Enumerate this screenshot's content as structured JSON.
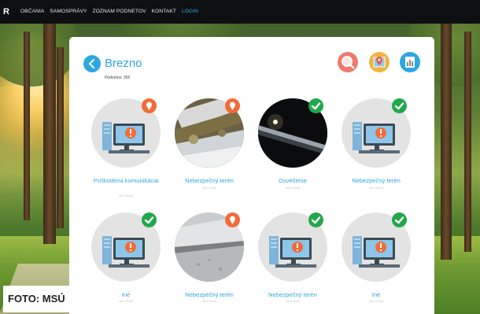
{
  "nav": {
    "logo": "R",
    "items": [
      "OBČANIA",
      "SAMOSPRÁVY",
      "ZOZNAM PODNETOV",
      "KONTAKT"
    ],
    "login": "LOGIN"
  },
  "page": {
    "title": "Brezno",
    "subtitle": "Podnetov: 356"
  },
  "toolbar": {
    "icons": [
      "search-icon",
      "map-icon",
      "stats-icon"
    ]
  },
  "tiles": [
    {
      "label": "Poškodená komunikácia",
      "date": "18.2.2016",
      "image": "placeholder",
      "status": "reported"
    },
    {
      "label": "Nebezpečný terén",
      "date": "18.2.2016",
      "image": "snow-photo",
      "status": "reported"
    },
    {
      "label": "Osvetlenie",
      "date": "18.2.2016",
      "image": "night-photo",
      "status": "resolved"
    },
    {
      "label": "Nebezpečný terén",
      "date": "18.2.2016",
      "image": "placeholder",
      "status": "resolved"
    },
    {
      "label": "Iné",
      "date": "18.2.2016",
      "image": "placeholder",
      "status": "resolved"
    },
    {
      "label": "Nebezpečný terén",
      "date": "18.2.2016",
      "image": "pavement-photo",
      "status": "reported"
    },
    {
      "label": "Nebezpečný terén",
      "date": "18.2.2016",
      "image": "placeholder",
      "status": "resolved"
    },
    {
      "label": "Iné",
      "date": "18.2.2016",
      "image": "placeholder",
      "status": "resolved"
    }
  ],
  "colors": {
    "accent": "#2ea7e0",
    "resolved": "#23a74b",
    "reported": "#f26b3a"
  },
  "caption": "FOTO: MSÚ"
}
